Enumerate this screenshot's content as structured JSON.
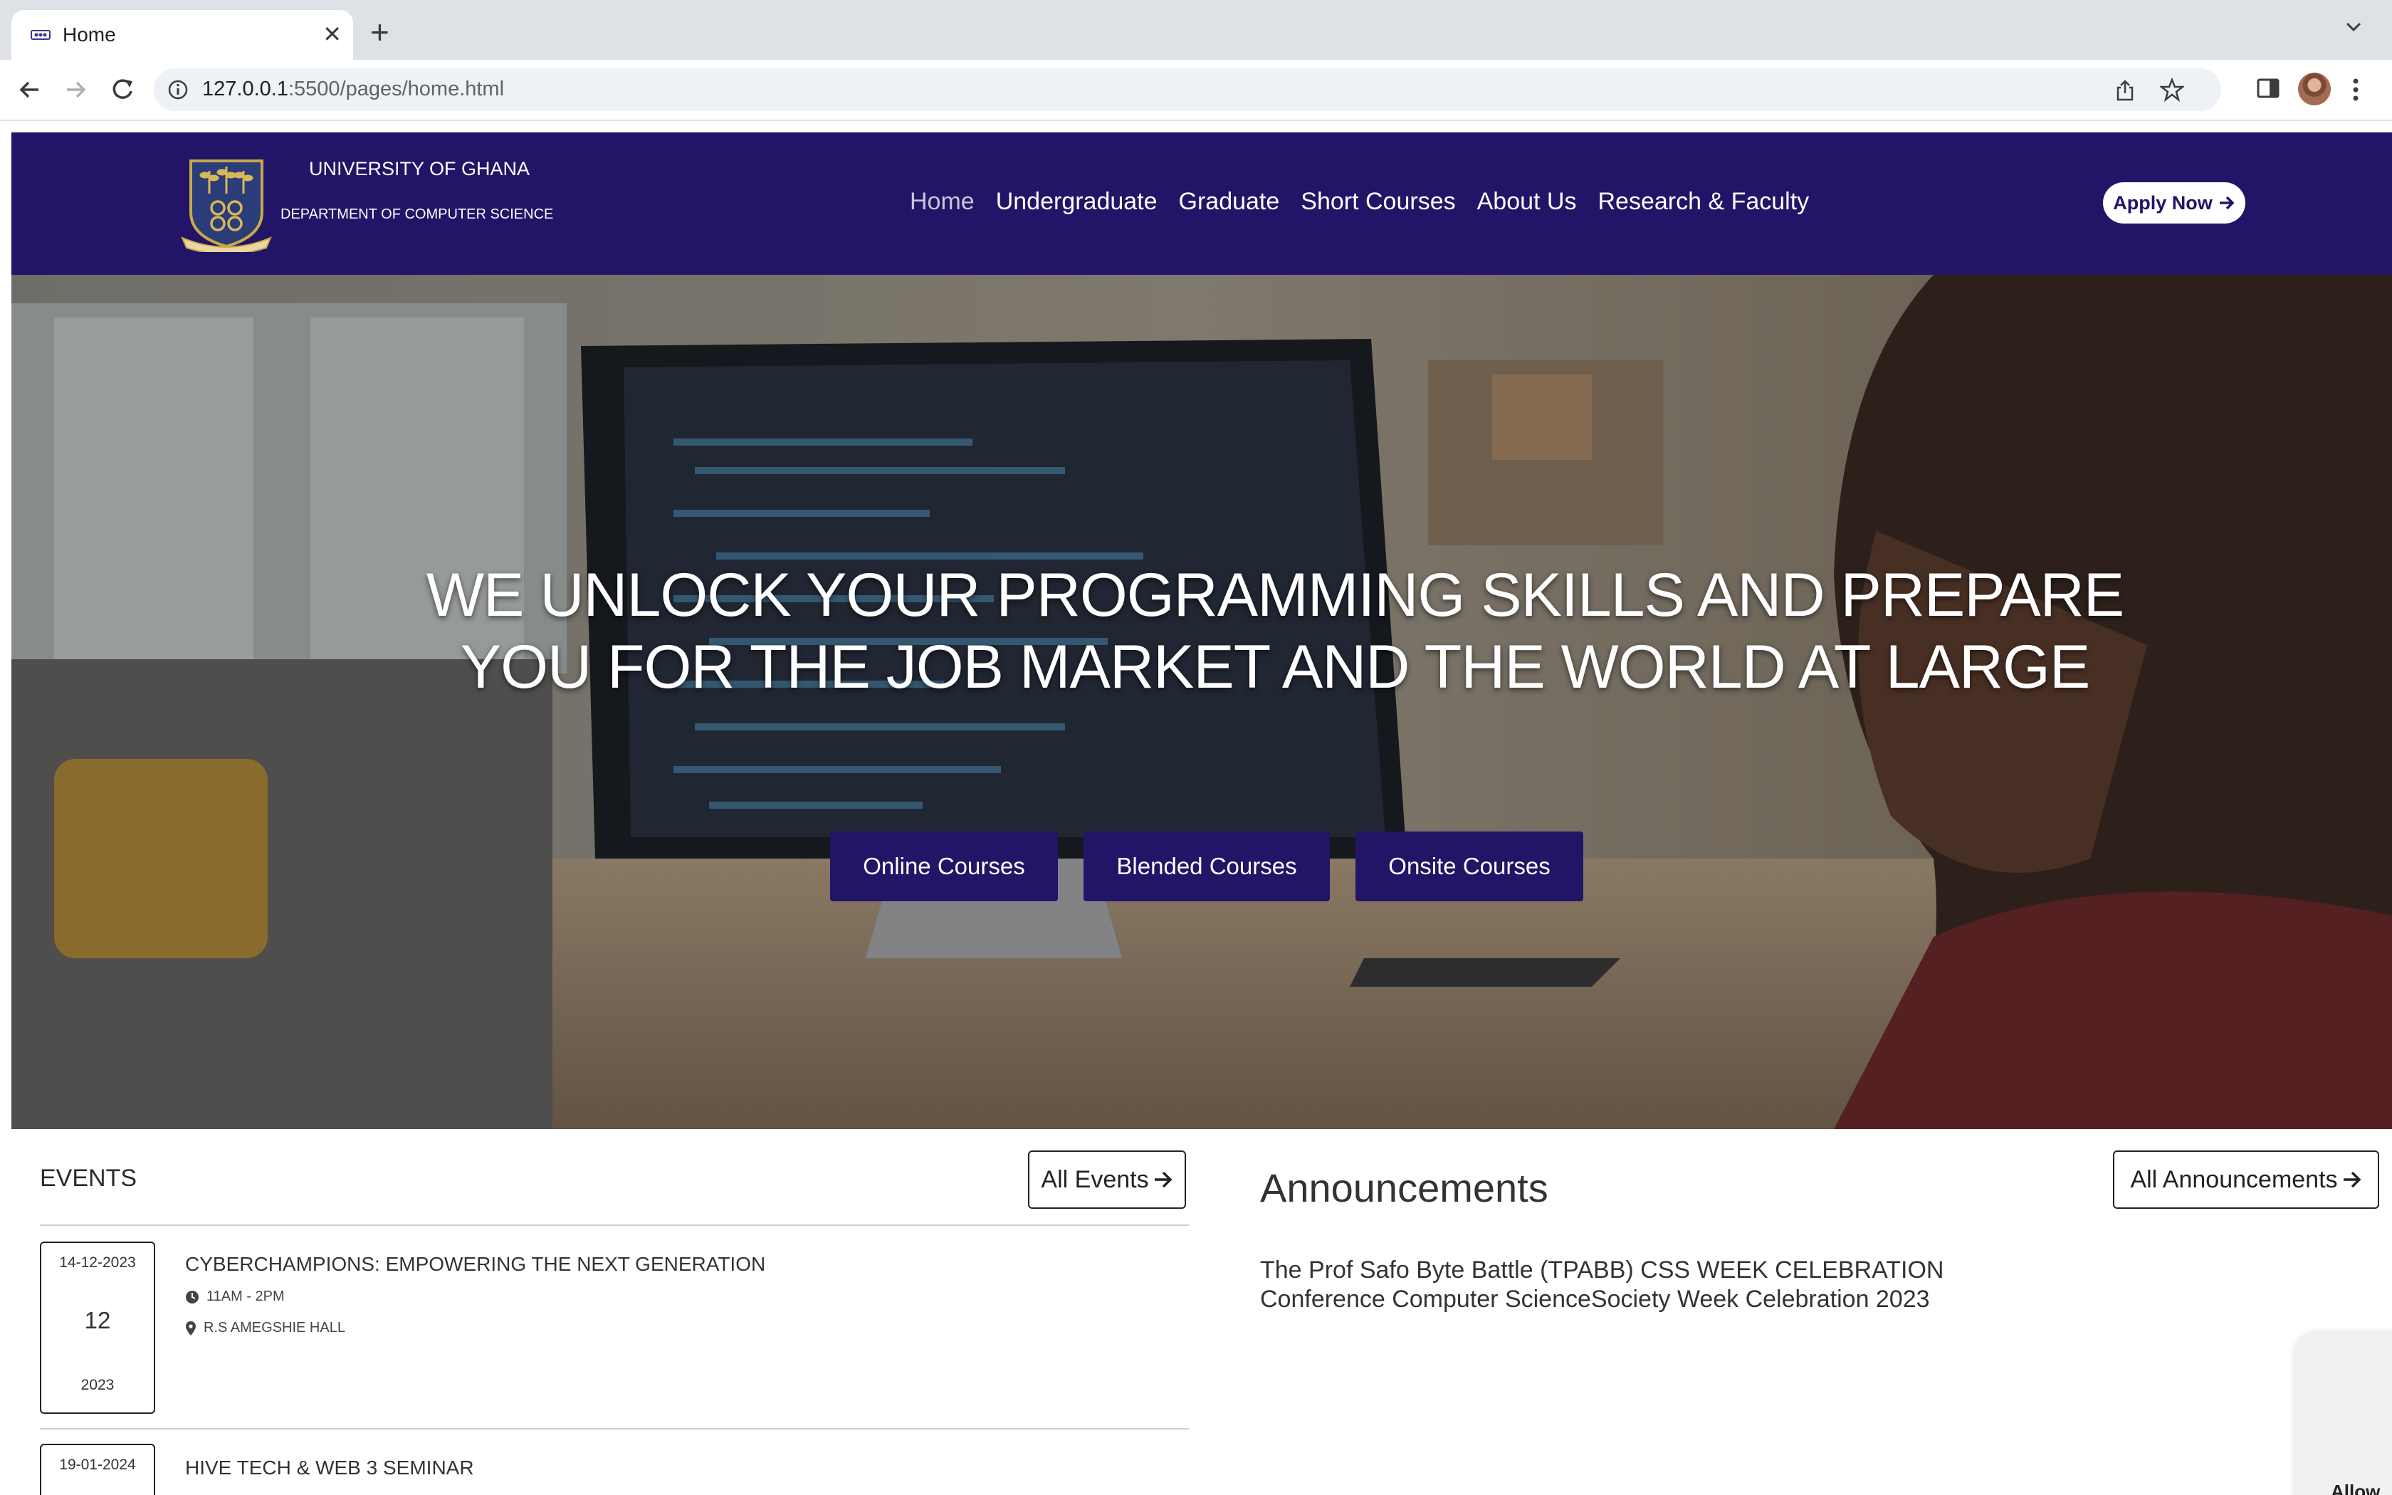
{
  "browser": {
    "tab_title": "Home",
    "url_host": "127.0.0.1",
    "url_path": ":5500/pages/home.html"
  },
  "header": {
    "university": "UNIVERSITY OF GHANA",
    "department": "DEPARTMENT OF COMPUTER SCIENCE",
    "nav": [
      "Home",
      "Undergraduate",
      "Graduate",
      "Short Courses",
      "About Us",
      "Research & Faculty"
    ],
    "active_nav": "Home",
    "apply_label": "Apply Now",
    "brand_color": "#221466"
  },
  "hero": {
    "headline": "WE UNLOCK YOUR PROGRAMMING SKILLS AND PREPARE YOU FOR THE JOB MARKET AND THE WORLD AT LARGE",
    "buttons": [
      "Online Courses",
      "Blended Courses",
      "Onsite Courses"
    ]
  },
  "events": {
    "title": "EVENTS",
    "all_label": "All Events",
    "items": [
      {
        "date": "14-12-2023",
        "day": "12",
        "year": "2023",
        "title": "CYBERCHAMPIONS: EMPOWERING THE NEXT GENERATION",
        "time": "11AM - 2PM",
        "location": "R.S AMEGSHIE HALL"
      },
      {
        "date": "19-01-2024",
        "title": "HIVE TECH & WEB 3 SEMINAR"
      }
    ]
  },
  "announcements": {
    "title": "Announcements",
    "all_label": "All Announcements",
    "text": "The Prof Safo Byte Battle (TPABB) CSS WEEK CELEBRATION Conference Computer ScienceSociety Week Celebration 2023"
  },
  "widget": {
    "partial_text": "Allow"
  }
}
